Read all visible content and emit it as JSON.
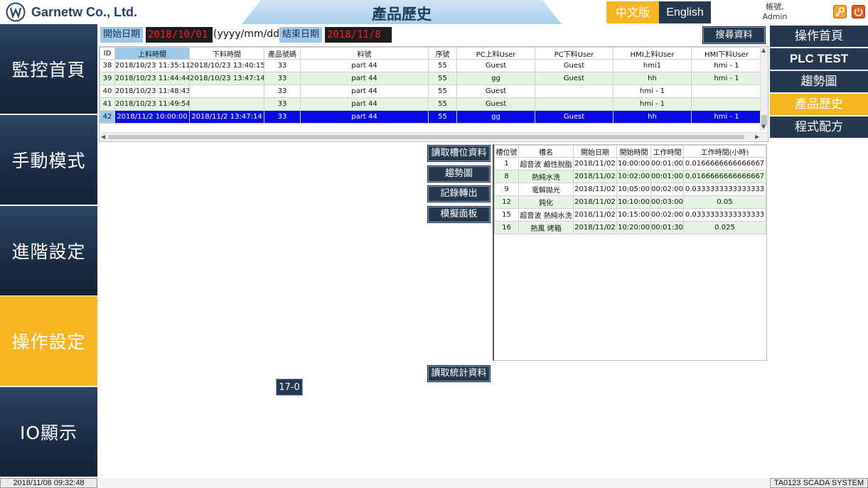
{
  "header": {
    "company": "Garnetw Co., Ltd.",
    "page_title": "產品歷史",
    "lang_zh": "中文版",
    "lang_en": "English",
    "account_label": "帳號,",
    "account_user": "Admin",
    "colors": {
      "accent": "#f6b623",
      "dark": "#243950",
      "title_band": "#a9cfec"
    },
    "icons": [
      "logo-icon",
      "key-icon",
      "power-icon"
    ]
  },
  "left_nav": [
    {
      "label": "監控首頁",
      "active": false
    },
    {
      "label": "手動模式",
      "active": false
    },
    {
      "label": "進階設定",
      "active": false
    },
    {
      "label": "操作設定",
      "active": true
    },
    {
      "label": "IO顯示",
      "active": false
    }
  ],
  "right_nav": [
    {
      "label": "操作首頁",
      "active": false
    },
    {
      "label": "PLC TEST",
      "active": false
    },
    {
      "label": "趨勢圖",
      "active": false
    },
    {
      "label": "產品歷史",
      "active": true
    },
    {
      "label": "程式配方",
      "active": false
    }
  ],
  "filter": {
    "start_label": "開始日期",
    "start_value": "2018/10/01",
    "format_hint": "(yyyy/mm/dd)",
    "end_label": "結束日期",
    "end_value": "2018/11/8",
    "search_button": "搜尋資料"
  },
  "history_table": {
    "headers": [
      "ID",
      "上料時間",
      "下料時間",
      "產品號碼",
      "料號",
      "序號",
      "PC上料User",
      "PC下料User",
      "HMI上料User",
      "HMI下料User"
    ],
    "rows": [
      [
        "38",
        "2018/10/23 11:35:11",
        "2018/10/23 13:40:15",
        "33",
        "part 44",
        "55",
        "Guest",
        "Guest",
        "hmi1",
        "hmi - 1"
      ],
      [
        "39",
        "2018/10/23 11:44:44",
        "2018/10/23 13:47:14",
        "33",
        "part 44",
        "55",
        "gg",
        "Guest",
        "hh",
        "hmi - 1"
      ],
      [
        "40",
        "2018/10/23 11:48:43",
        "",
        "33",
        "part 44",
        "55",
        "Guest",
        "",
        "hmi - 1",
        ""
      ],
      [
        "41",
        "2018/10/23 11:49:54",
        "",
        "33",
        "part 44",
        "55",
        "Guest",
        "",
        "hmi - 1",
        ""
      ],
      [
        "42",
        "2018/11/2 10:00:00",
        "2018/11/2 13:47:14",
        "33",
        "part 44",
        "55",
        "gg",
        "Guest",
        "hh",
        "hmi - 1"
      ]
    ],
    "selected_row": 4
  },
  "actions": {
    "read_slot": "讀取槽位資料",
    "trend": "趨勢圖",
    "export": "記錄轉出",
    "simulate": "模擬面板",
    "read_stats": "讀取統計資料",
    "tag": "17-0"
  },
  "slot_table": {
    "headers": [
      "槽位號",
      "槽名",
      "開始日期",
      "開始時間",
      "工作時間",
      "工作時間(小時)"
    ],
    "rows": [
      [
        "1",
        "超音波 鹼性脫脂",
        "2018/11/02",
        "10:00:00",
        "00:01:00",
        "0.0166666666666667"
      ],
      [
        "8",
        "熱純水洗",
        "2018/11/02",
        "10:02:00",
        "00:01:00",
        "0.0166666666666667"
      ],
      [
        "9",
        "電解拋光",
        "2018/11/02",
        "10:05:00",
        "00:02:00",
        "0.0333333333333333"
      ],
      [
        "12",
        "鈍化",
        "2018/11/02",
        "10:10:00",
        "00:03:00",
        "0.05"
      ],
      [
        "15",
        "超音波 熱純水洗",
        "2018/11/02",
        "10:15:00",
        "00:02:00",
        "0.0333333333333333"
      ],
      [
        "16",
        "熱風 烤箱",
        "2018/11/02",
        "10:20:00",
        "00:01:30",
        "0.025"
      ]
    ]
  },
  "status": {
    "datetime": "2018/11/08 09:32:48",
    "system": "TA0123 SCADA SYSTEM"
  }
}
